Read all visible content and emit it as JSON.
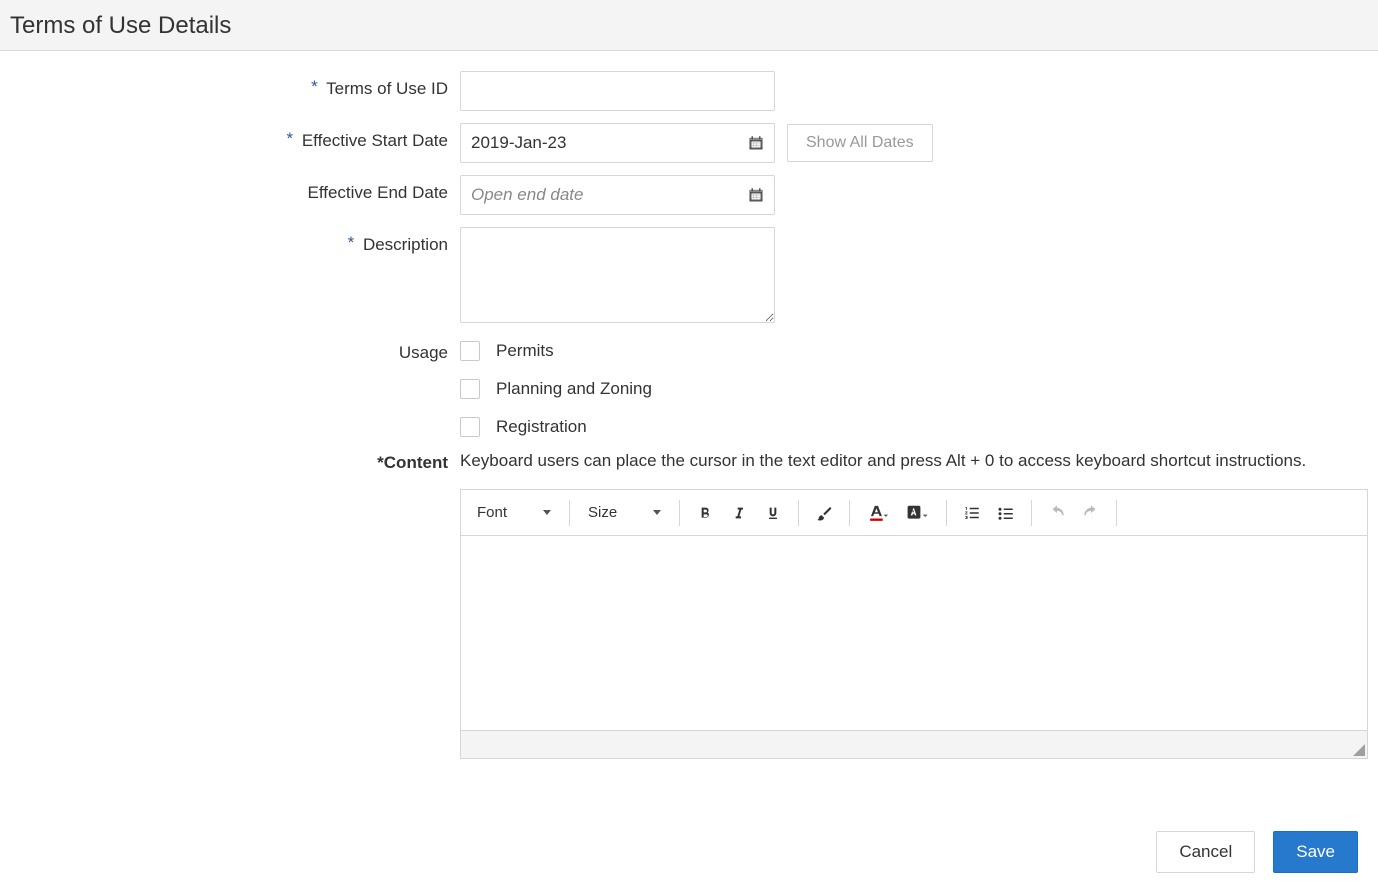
{
  "header": {
    "title": "Terms of Use Details"
  },
  "form": {
    "terms_id": {
      "label": "Terms of Use ID",
      "value": "",
      "required": true
    },
    "start_date": {
      "label": "Effective Start Date",
      "value": "2019-Jan-23",
      "required": true
    },
    "end_date": {
      "label": "Effective End Date",
      "value": "",
      "placeholder": "Open end date",
      "required": false
    },
    "show_all_dates_label": "Show All Dates",
    "description": {
      "label": "Description",
      "value": "",
      "required": true
    },
    "usage": {
      "label": "Usage",
      "options": [
        {
          "label": "Permits",
          "checked": false
        },
        {
          "label": "Planning and Zoning",
          "checked": false
        },
        {
          "label": "Registration",
          "checked": false
        }
      ]
    },
    "content": {
      "label": "Content",
      "required_marker": "*",
      "hint": "Keyboard users can place the cursor in the text editor and press Alt + 0 to access keyboard shortcut instructions."
    }
  },
  "editor_toolbar": {
    "font_label": "Font",
    "size_label": "Size"
  },
  "actions": {
    "cancel": "Cancel",
    "save": "Save"
  }
}
